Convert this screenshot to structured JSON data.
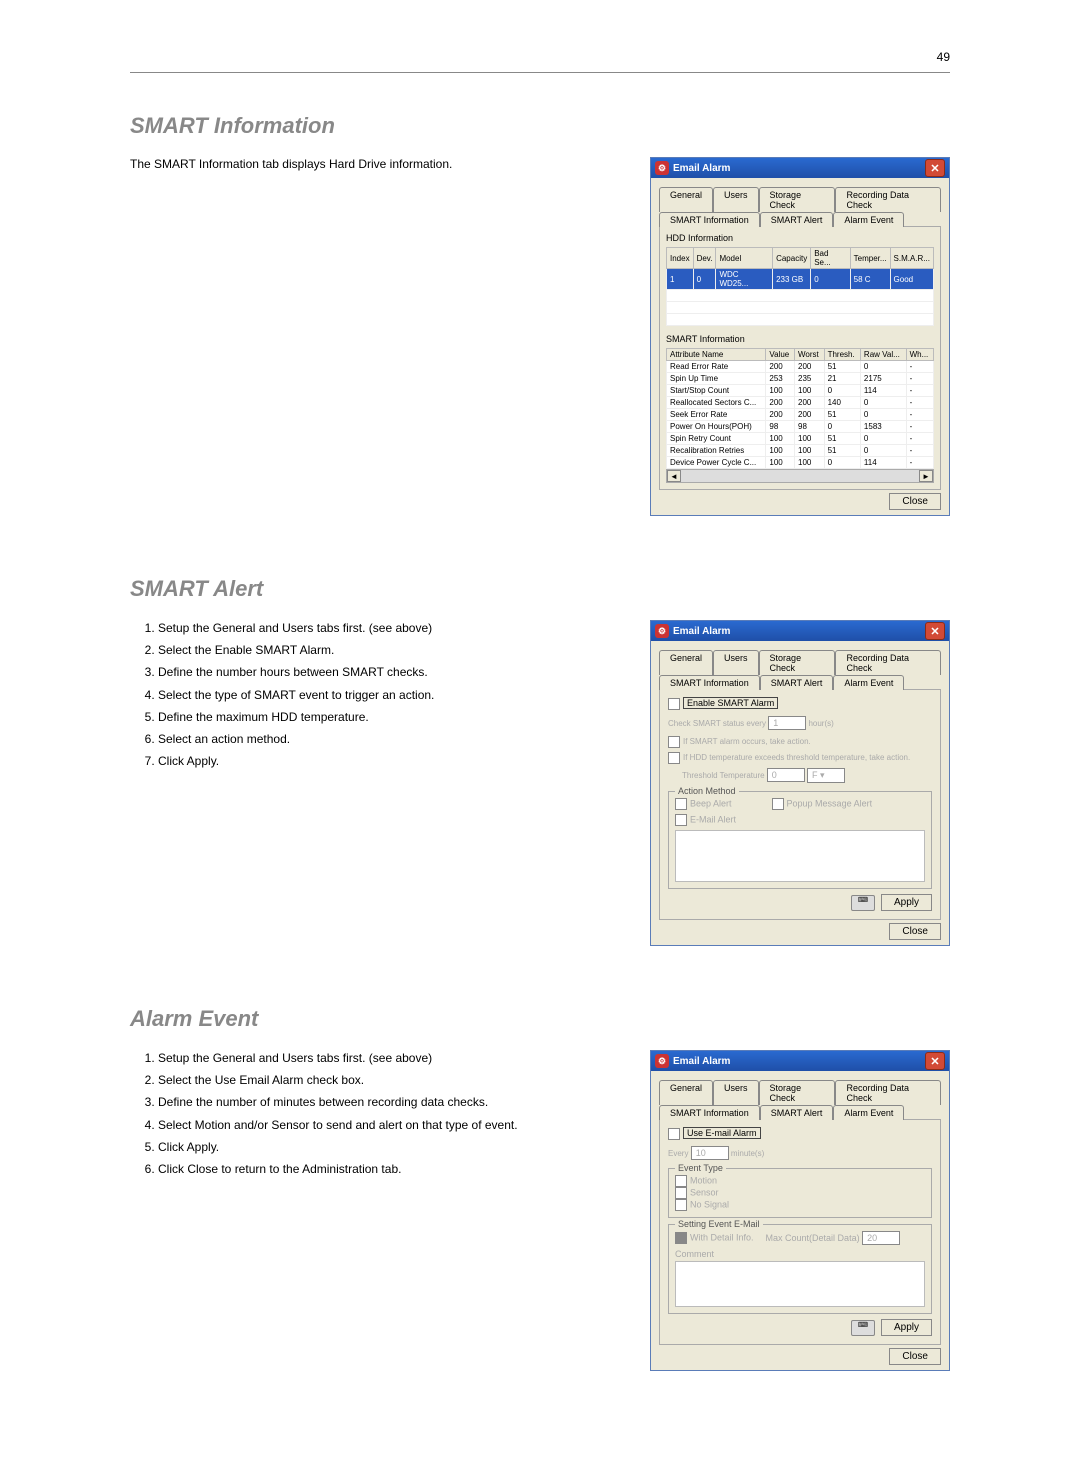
{
  "page_number": "49",
  "section1": {
    "heading": "SMART Information",
    "intro": "The SMART Information tab displays Hard Drive information.",
    "dialog": {
      "title": "Email Alarm",
      "tabs_row1": [
        "General",
        "Users",
        "Storage Check",
        "Recording Data Check"
      ],
      "tabs_row2": [
        "SMART Information",
        "SMART Alert",
        "Alarm Event"
      ],
      "hdd_label": "HDD Information",
      "hdd_headers": [
        "Index",
        "Dev.",
        "Model",
        "Capacity",
        "Bad Se...",
        "Temper...",
        "S.M.A.R..."
      ],
      "hdd_row": [
        "1",
        "0",
        "WDC WD25...",
        "233 GB",
        "0",
        "58 C",
        "Good"
      ],
      "smart_label": "SMART Information",
      "smart_headers": [
        "Attribute Name",
        "Value",
        "Worst",
        "Thresh.",
        "Raw Val...",
        "Wh..."
      ],
      "smart_rows": [
        [
          "Read Error Rate",
          "200",
          "200",
          "51",
          "0",
          "-"
        ],
        [
          "Spin Up Time",
          "253",
          "235",
          "21",
          "2175",
          "-"
        ],
        [
          "Start/Stop Count",
          "100",
          "100",
          "0",
          "114",
          "-"
        ],
        [
          "Reallocated Sectors C...",
          "200",
          "200",
          "140",
          "0",
          "-"
        ],
        [
          "Seek Error Rate",
          "200",
          "200",
          "51",
          "0",
          "-"
        ],
        [
          "Power On Hours(POH)",
          "98",
          "98",
          "0",
          "1583",
          "-"
        ],
        [
          "Spin Retry Count",
          "100",
          "100",
          "51",
          "0",
          "-"
        ],
        [
          "Recalibration Retries",
          "100",
          "100",
          "51",
          "0",
          "-"
        ],
        [
          "Device Power Cycle C...",
          "100",
          "100",
          "0",
          "114",
          "-"
        ]
      ],
      "close": "Close"
    }
  },
  "section2": {
    "heading": "SMART Alert",
    "steps": [
      "Setup the General and Users tabs first. (see above)",
      "Select the Enable SMART Alarm.",
      "Define the number hours between SMART checks.",
      "Select the type of SMART event to trigger an action.",
      "Define the maximum HDD temperature.",
      "Select an action method.",
      "Click Apply."
    ],
    "dialog": {
      "title": "Email Alarm",
      "tabs_row1": [
        "General",
        "Users",
        "Storage Check",
        "Recording Data Check"
      ],
      "tabs_row2": [
        "SMART Information",
        "SMART Alert",
        "Alarm Event"
      ],
      "enable": "Enable SMART Alarm",
      "check_every": "Check SMART status every",
      "check_val": "1",
      "check_unit": "hour(s)",
      "if_alarm": "If SMART alarm occurs, take action.",
      "if_temp": "If HDD temperature exceeds threshold temperature, take action.",
      "thresh_label": "Threshold Temperature",
      "thresh_val": "0",
      "thresh_unit": "F",
      "action_label": "Action Method",
      "beep": "Beep Alert",
      "popup": "Popup Message Alert",
      "email": "E-Mail Alert",
      "apply": "Apply",
      "close": "Close"
    }
  },
  "section3": {
    "heading": "Alarm Event",
    "steps": [
      "Setup the General and Users tabs first. (see above)",
      "Select the Use Email Alarm check box.",
      "Define the number of minutes between recording data checks.",
      "Select Motion and/or Sensor to send and alert on that type of event.",
      "Click Apply.",
      "Click Close to return to the Administration tab."
    ],
    "dialog": {
      "title": "Email Alarm",
      "tabs_row1": [
        "General",
        "Users",
        "Storage Check",
        "Recording Data Check"
      ],
      "tabs_row2": [
        "SMART Information",
        "SMART Alert",
        "Alarm Event"
      ],
      "use_email": "Use E-mail Alarm",
      "every": "Every",
      "every_val": "10",
      "every_unit": "minute(s)",
      "event_label": "Event Type",
      "motion": "Motion",
      "sensor": "Sensor",
      "nosignal": "No Signal",
      "setting_label": "Setting Event E-Mail",
      "with_detail": "With Detail Info.",
      "max_count": "Max Count(Detail Data)",
      "max_val": "20",
      "comment": "Comment",
      "apply": "Apply",
      "close": "Close"
    }
  }
}
